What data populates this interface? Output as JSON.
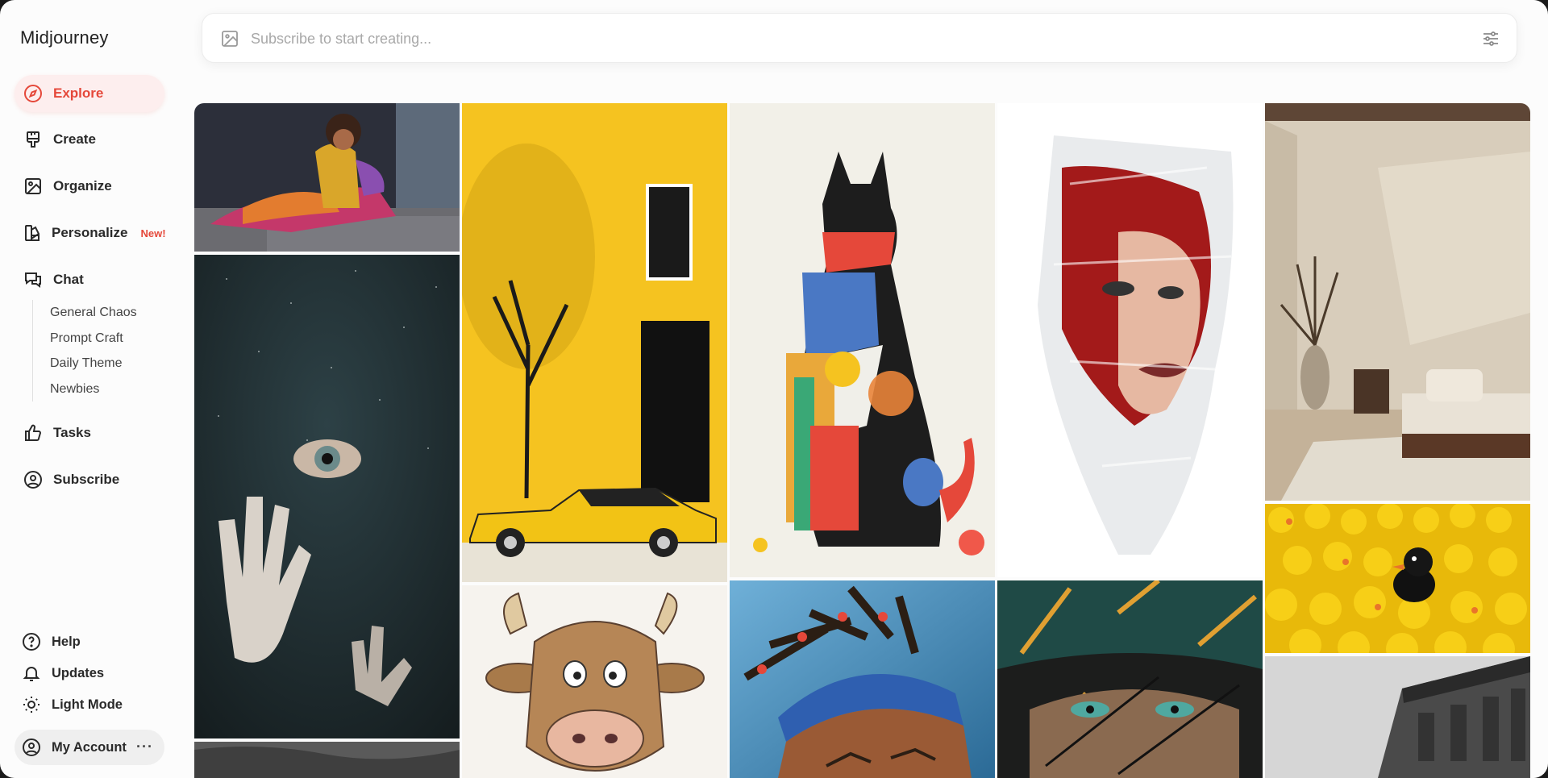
{
  "app": {
    "brand": "Midjourney"
  },
  "nav": {
    "items": [
      {
        "id": "explore",
        "label": "Explore",
        "icon": "compass-icon",
        "active": true
      },
      {
        "id": "create",
        "label": "Create",
        "icon": "brush-icon"
      },
      {
        "id": "organize",
        "label": "Organize",
        "icon": "image-icon"
      },
      {
        "id": "personalize",
        "label": "Personalize",
        "icon": "palette-icon",
        "badge": "New!"
      },
      {
        "id": "chat",
        "label": "Chat",
        "icon": "chat-icon"
      }
    ],
    "chat_channels": [
      "General Chaos",
      "Prompt Craft",
      "Daily Theme",
      "Newbies"
    ],
    "tasks": {
      "label": "Tasks",
      "icon": "thumbs-up-icon"
    },
    "subscribe": {
      "label": "Subscribe",
      "icon": "user-circle-icon"
    }
  },
  "footer": {
    "help": "Help",
    "updates": "Updates",
    "light_mode": "Light Mode",
    "account": "My Account",
    "account_menu": "···"
  },
  "prompt": {
    "placeholder": "Subscribe to start creating..."
  },
  "gallery": {
    "tiles": [
      {
        "name": "tile-reclining-woman",
        "subject": "illustrated woman reclining in colorful outfit"
      },
      {
        "name": "tile-eye-hands",
        "subject": "eye in dark starry sky with reaching hands"
      },
      {
        "name": "tile-texture",
        "subject": "grey textured detail"
      },
      {
        "name": "tile-yellow-street",
        "subject": "yellow wall with tree and yellow car"
      },
      {
        "name": "tile-cow-cartoon",
        "subject": "cartoon cow head"
      },
      {
        "name": "tile-cat-sculpture",
        "subject": "geometric cat sculpture"
      },
      {
        "name": "tile-headdress",
        "subject": "man in feathered headdress"
      },
      {
        "name": "tile-wrapped-face",
        "subject": "face wrapped in plastic"
      },
      {
        "name": "tile-warrior-eyes",
        "subject": "painted warrior with green eyes"
      },
      {
        "name": "tile-bedroom",
        "subject": "minimal beige bedroom"
      },
      {
        "name": "tile-rubber-ducks",
        "subject": "yellow rubber ducks with one black duck"
      },
      {
        "name": "tile-building",
        "subject": "grey classical building"
      }
    ]
  },
  "colors": {
    "accent": "#e5483a",
    "active_bg": "#fdeeee"
  }
}
